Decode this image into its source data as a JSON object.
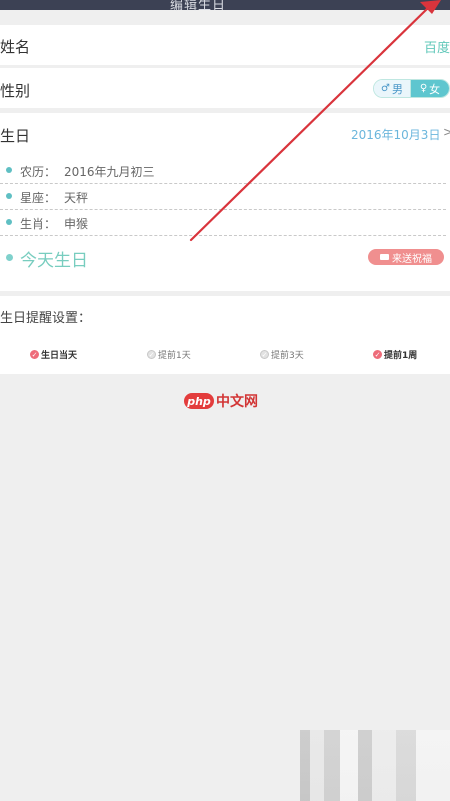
{
  "header": {
    "title": "编辑生日"
  },
  "name_row": {
    "label": "姓名",
    "value": "百度"
  },
  "gender_row": {
    "label": "性别",
    "male": "男",
    "female": "女",
    "selected": "female"
  },
  "birthday": {
    "label": "生日",
    "date": "2016年10月3日",
    "chevron": ">",
    "lunar_key": "农历：",
    "lunar_value": "2016年九月初三",
    "zodiac_key": "星座：",
    "zodiac_value": "天秤",
    "animal_key": "生肖：",
    "animal_value": "申猴",
    "today_text": "今天生日",
    "send_button": "来送祝福"
  },
  "reminder": {
    "label": "生日提醒设置：",
    "options": [
      {
        "label": "生日当天",
        "checked": true
      },
      {
        "label": "提前1天",
        "checked": false
      },
      {
        "label": "提前3天",
        "checked": false
      },
      {
        "label": "提前1周",
        "checked": true
      }
    ]
  },
  "watermark": {
    "badge": "php",
    "text": "中文网"
  },
  "colors": {
    "accent": "#5ec6cf",
    "teal_text": "#78cdbf",
    "check_on": "#ee6c7a",
    "arrow": "#d9343c"
  }
}
